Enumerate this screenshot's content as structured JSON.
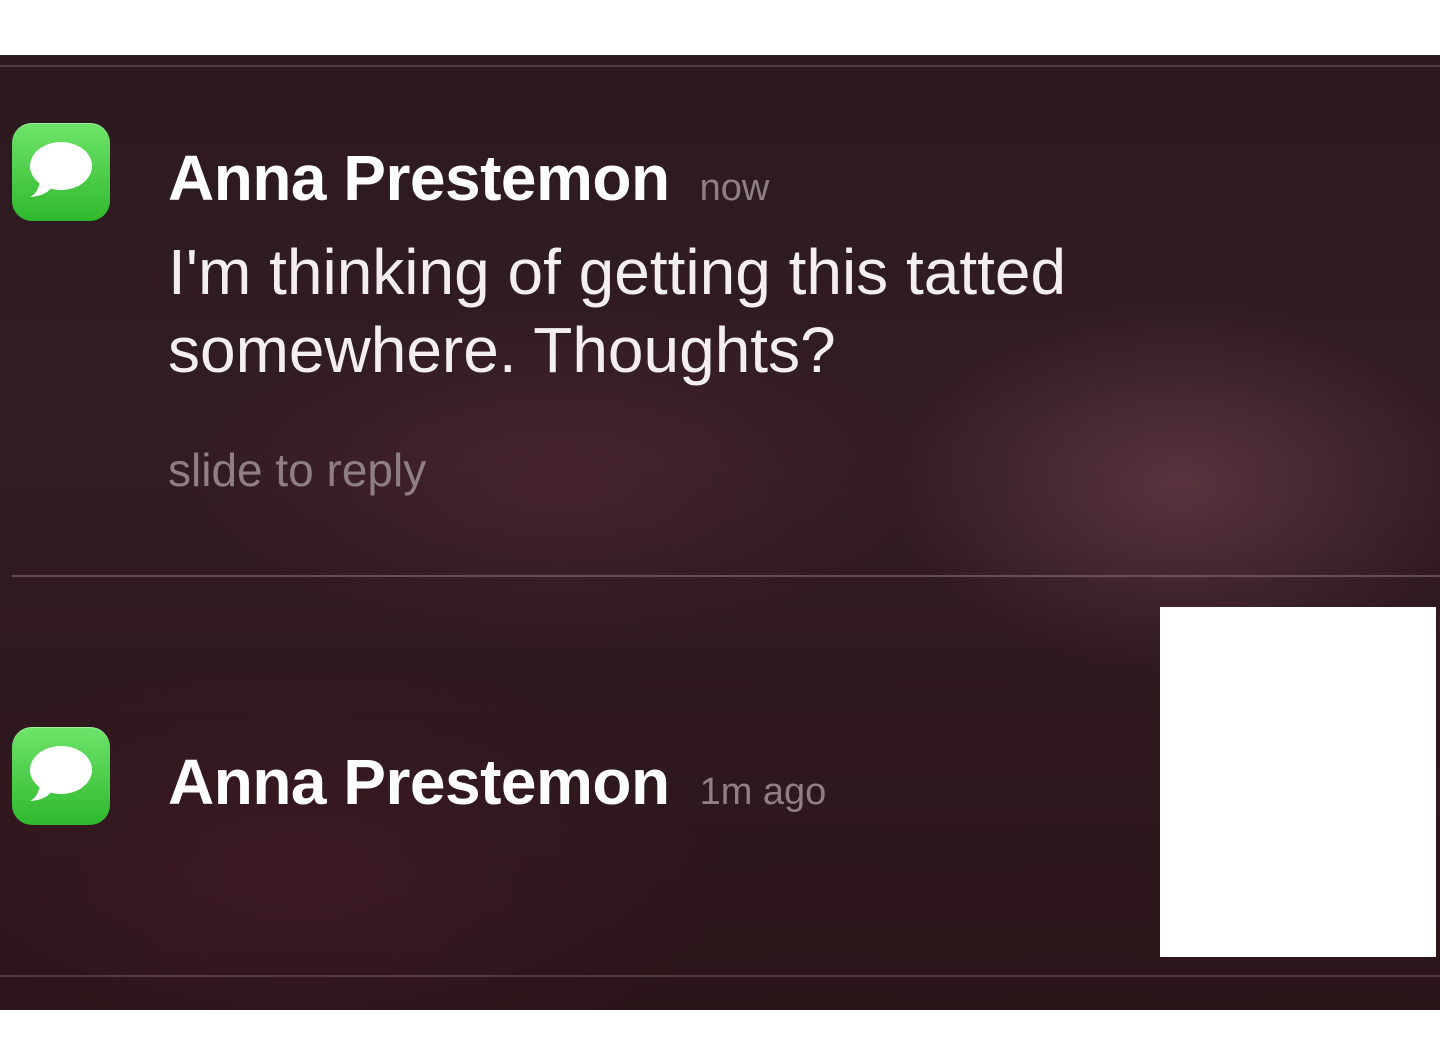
{
  "notifications": [
    {
      "app_icon": "messages-icon",
      "sender": "Anna Prestemon",
      "time": "now",
      "message": "I'm thinking of getting this tatted somewhere. Thoughts?",
      "action_hint": "slide to reply"
    },
    {
      "app_icon": "messages-icon",
      "sender": "Anna Prestemon",
      "time": "1m ago"
    }
  ],
  "colors": {
    "background": "#2c1a1f",
    "icon_green": "#3cc43a",
    "primary_text": "#ffffff",
    "secondary_text": "#8f7f84",
    "redaction": "#ffffff"
  }
}
